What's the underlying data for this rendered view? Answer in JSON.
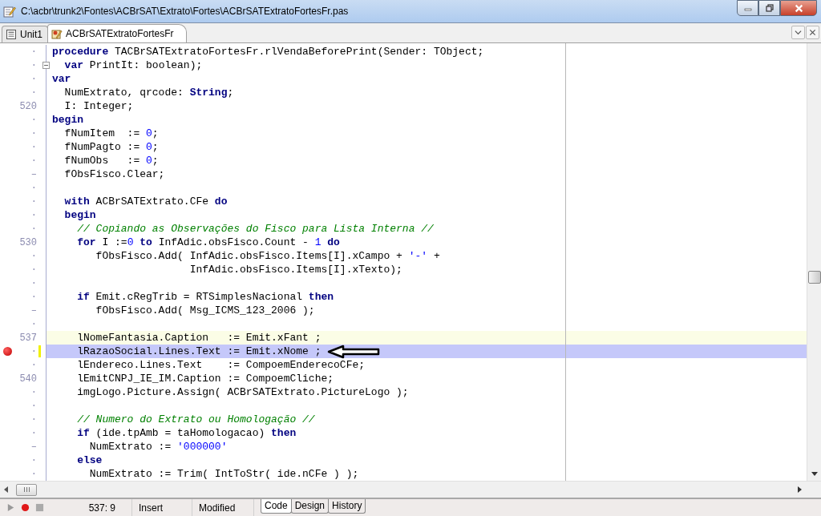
{
  "window": {
    "title": "C:\\acbr\\trunk2\\Fontes\\ACBrSAT\\Extrato\\Fortes\\ACBrSATExtratoFortesFr.pas"
  },
  "tabs": [
    {
      "label": "Unit1",
      "kind": "unit",
      "selected": false
    },
    {
      "label": "ACBrSATExtratoFortesFr",
      "kind": "form",
      "selected": true
    }
  ],
  "editor": {
    "lines": [
      {
        "gutter": "·",
        "current_line": false,
        "breakpoint": false,
        "tokens": [
          {
            "kind": "kw",
            "text": "procedure"
          },
          {
            "kind": "plain",
            "text": " TACBrSATExtratoFortesFr.rlVendaBeforePrint(Sender: TObject;"
          }
        ]
      },
      {
        "gutter": "·",
        "current_line": false,
        "breakpoint": false,
        "fold_box": true,
        "tokens": [
          {
            "kind": "kw",
            "text": "  var"
          },
          {
            "kind": "plain",
            "text": " PrintIt: boolean);"
          }
        ]
      },
      {
        "gutter": "·",
        "current_line": false,
        "breakpoint": false,
        "tokens": [
          {
            "kind": "kw",
            "text": "var"
          }
        ]
      },
      {
        "gutter": "·",
        "current_line": false,
        "breakpoint": false,
        "tokens": [
          {
            "kind": "plain",
            "text": "  NumExtrato, qrcode: "
          },
          {
            "kind": "kw",
            "text": "String"
          },
          {
            "kind": "plain",
            "text": ";"
          }
        ]
      },
      {
        "gutter": "520",
        "current_line": false,
        "breakpoint": false,
        "tokens": [
          {
            "kind": "plain",
            "text": "  I: Integer;"
          }
        ]
      },
      {
        "gutter": "·",
        "current_line": false,
        "breakpoint": false,
        "tokens": [
          {
            "kind": "kw",
            "text": "begin"
          }
        ]
      },
      {
        "gutter": "·",
        "current_line": false,
        "breakpoint": false,
        "tokens": [
          {
            "kind": "plain",
            "text": "  fNumItem  := "
          },
          {
            "kind": "num",
            "text": "0"
          },
          {
            "kind": "plain",
            "text": ";"
          }
        ]
      },
      {
        "gutter": "·",
        "current_line": false,
        "breakpoint": false,
        "tokens": [
          {
            "kind": "plain",
            "text": "  fNumPagto := "
          },
          {
            "kind": "num",
            "text": "0"
          },
          {
            "kind": "plain",
            "text": ";"
          }
        ]
      },
      {
        "gutter": "·",
        "current_line": false,
        "breakpoint": false,
        "tokens": [
          {
            "kind": "plain",
            "text": "  fNumObs   := "
          },
          {
            "kind": "num",
            "text": "0"
          },
          {
            "kind": "plain",
            "text": ";"
          }
        ]
      },
      {
        "gutter": "–",
        "current_line": false,
        "breakpoint": false,
        "tokens": [
          {
            "kind": "plain",
            "text": "  fObsFisco.Clear;"
          }
        ]
      },
      {
        "gutter": "·",
        "current_line": false,
        "breakpoint": false
      },
      {
        "gutter": "·",
        "current_line": false,
        "breakpoint": false,
        "tokens": [
          {
            "kind": "kw",
            "text": "  with"
          },
          {
            "kind": "plain",
            "text": " ACBrSATExtrato.CFe "
          },
          {
            "kind": "kw",
            "text": "do"
          }
        ]
      },
      {
        "gutter": "·",
        "current_line": false,
        "breakpoint": false,
        "tokens": [
          {
            "kind": "kw",
            "text": "  begin"
          }
        ]
      },
      {
        "gutter": "·",
        "current_line": false,
        "breakpoint": false,
        "tokens": [
          {
            "kind": "comment",
            "text": "    // Copiando as Observações do Fisco para Lista Interna //"
          }
        ]
      },
      {
        "gutter": "530",
        "current_line": false,
        "breakpoint": false,
        "tokens": [
          {
            "kind": "kw",
            "text": "    for"
          },
          {
            "kind": "plain",
            "text": " I :="
          },
          {
            "kind": "num",
            "text": "0"
          },
          {
            "kind": "kw",
            "text": " to"
          },
          {
            "kind": "plain",
            "text": " InfAdic.obsFisco.Count - "
          },
          {
            "kind": "num",
            "text": "1"
          },
          {
            "kind": "kw",
            "text": " do"
          }
        ]
      },
      {
        "gutter": "·",
        "current_line": false,
        "breakpoint": false,
        "tokens": [
          {
            "kind": "plain",
            "text": "       fObsFisco.Add( InfAdic.obsFisco.Items[I].xCampo + "
          },
          {
            "kind": "str",
            "text": "'-'"
          },
          {
            "kind": "plain",
            "text": " +"
          }
        ]
      },
      {
        "gutter": "·",
        "current_line": false,
        "breakpoint": false,
        "tokens": [
          {
            "kind": "plain",
            "text": "                      InfAdic.obsFisco.Items[I].xTexto);"
          }
        ]
      },
      {
        "gutter": "·",
        "current_line": false,
        "breakpoint": false
      },
      {
        "gutter": "·",
        "current_line": false,
        "breakpoint": false,
        "tokens": [
          {
            "kind": "kw",
            "text": "    if"
          },
          {
            "kind": "plain",
            "text": " Emit.cRegTrib = RTSimplesNacional "
          },
          {
            "kind": "kw",
            "text": "then"
          }
        ]
      },
      {
        "gutter": "–",
        "current_line": false,
        "breakpoint": false,
        "tokens": [
          {
            "kind": "plain",
            "text": "       fObsFisco.Add( Msg_ICMS_123_2006 );"
          }
        ]
      },
      {
        "gutter": "·",
        "current_line": false,
        "breakpoint": false
      },
      {
        "gutter": "537",
        "current_line": true,
        "breakpoint": false,
        "tokens": [
          {
            "kind": "plain",
            "text": "    lNomeFantasia.Caption   := Emit.xFant ;"
          }
        ]
      },
      {
        "gutter": "·",
        "current_line": false,
        "breakpoint": true,
        "change_bar": true,
        "tokens": [
          {
            "kind": "plain",
            "text": "    lRazaoSocial.Lines.Text := Emit.xNome ;"
          }
        ]
      },
      {
        "gutter": "·",
        "current_line": false,
        "breakpoint": false,
        "tokens": [
          {
            "kind": "plain",
            "text": "    lEndereco.Lines.Text    := CompoemEnderecoCFe;"
          }
        ]
      },
      {
        "gutter": "540",
        "current_line": false,
        "breakpoint": false,
        "tokens": [
          {
            "kind": "plain",
            "text": "    lEmitCNPJ_IE_IM.Caption := CompoemCliche;"
          }
        ]
      },
      {
        "gutter": "·",
        "current_line": false,
        "breakpoint": false,
        "tokens": [
          {
            "kind": "plain",
            "text": "    imgLogo.Picture.Assign( ACBrSATExtrato.PictureLogo );"
          }
        ]
      },
      {
        "gutter": "·",
        "current_line": false,
        "breakpoint": false
      },
      {
        "gutter": "·",
        "current_line": false,
        "breakpoint": false,
        "tokens": [
          {
            "kind": "comment",
            "text": "    // Numero do Extrato ou Homologação //"
          }
        ]
      },
      {
        "gutter": "·",
        "current_line": false,
        "breakpoint": false,
        "tokens": [
          {
            "kind": "kw",
            "text": "    if"
          },
          {
            "kind": "plain",
            "text": " (ide.tpAmb = taHomologacao) "
          },
          {
            "kind": "kw",
            "text": "then"
          }
        ]
      },
      {
        "gutter": "–",
        "current_line": false,
        "breakpoint": false,
        "tokens": [
          {
            "kind": "plain",
            "text": "      NumExtrato := "
          },
          {
            "kind": "str",
            "text": "'000000'"
          }
        ]
      },
      {
        "gutter": "·",
        "current_line": false,
        "breakpoint": false,
        "tokens": [
          {
            "kind": "kw",
            "text": "    else"
          }
        ]
      },
      {
        "gutter": "·",
        "current_line": false,
        "breakpoint": false,
        "tokens": [
          {
            "kind": "plain",
            "text": "      NumExtrato := Trim( IntToStr( ide.nCFe ) );"
          }
        ]
      }
    ]
  },
  "status_bar": {
    "position": "537:  9",
    "mode": "Insert",
    "state": "Modified",
    "view_tabs": [
      {
        "label": "Code",
        "selected": true
      },
      {
        "label": "Design",
        "selected": false
      },
      {
        "label": "History",
        "selected": false
      }
    ]
  }
}
